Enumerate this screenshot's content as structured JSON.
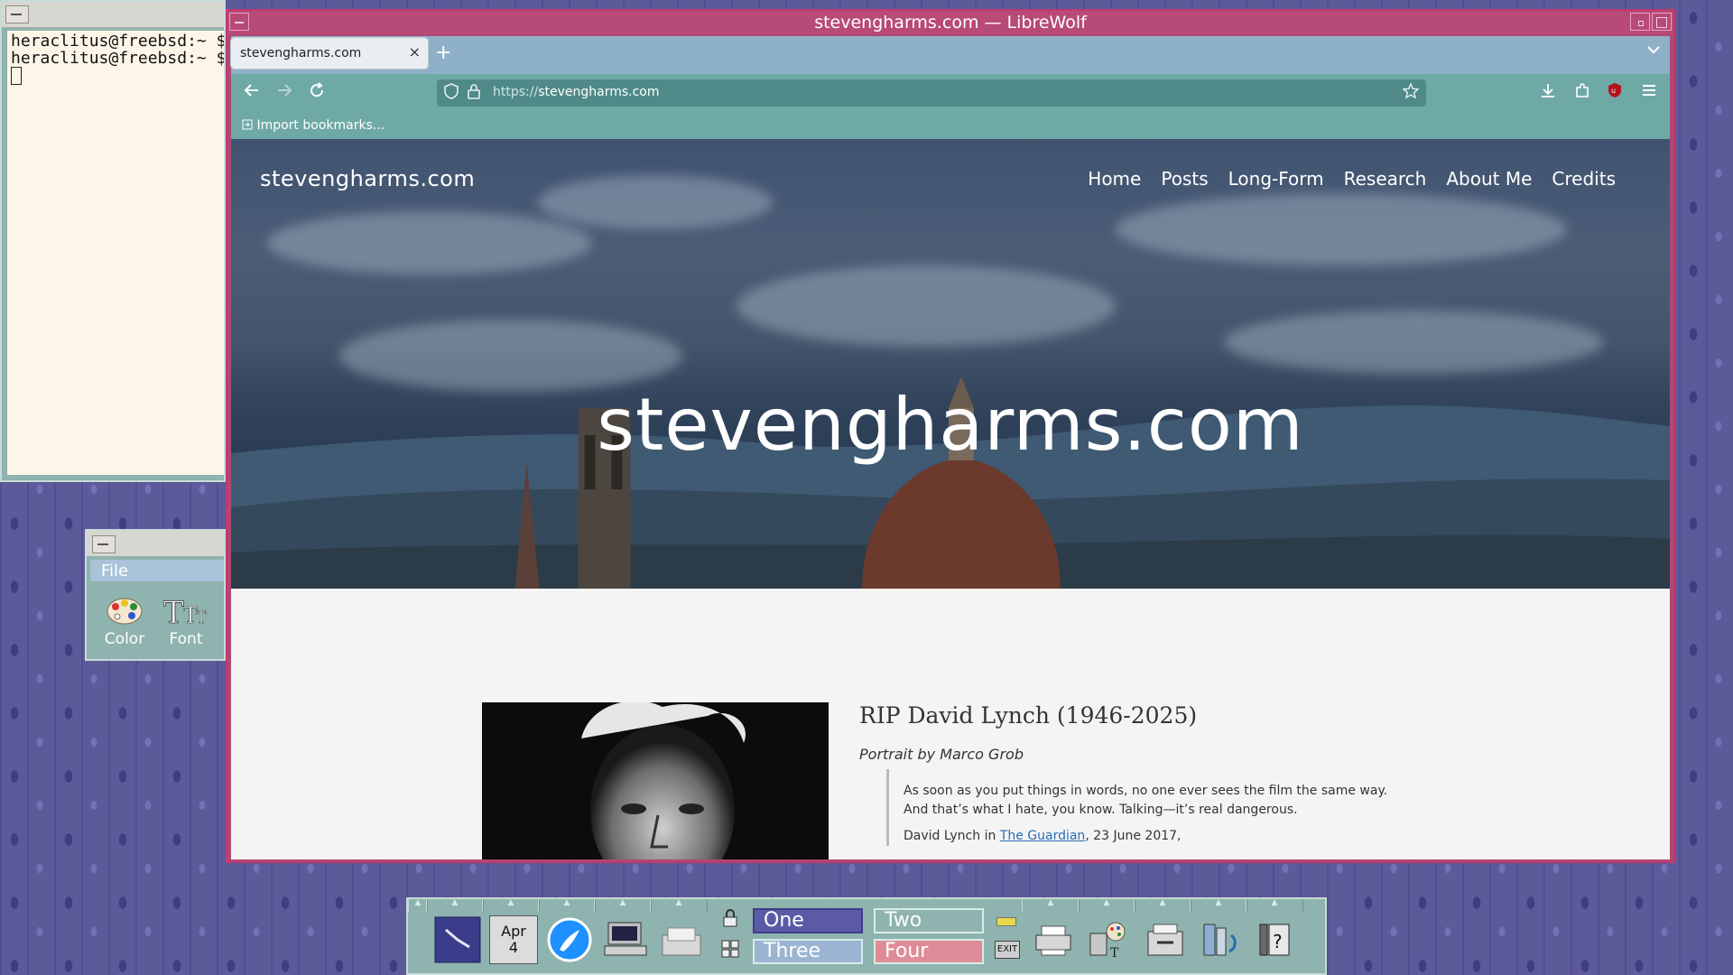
{
  "terminal": {
    "lines": [
      "heraclitus@freebsd:~ $",
      "heraclitus@freebsd:~ $"
    ]
  },
  "style_manager": {
    "menu_file": "File",
    "icons": [
      {
        "label": "Color",
        "icon": "palette-icon"
      },
      {
        "label": "Font",
        "icon": "font-icon"
      }
    ]
  },
  "browser": {
    "window_title": "stevengharms.com — LibreWolf",
    "tab_title": "stevengharms.com",
    "tab_close": "×",
    "new_tab": "+",
    "url_scheme": "https://",
    "url_host": "stevengharms.com",
    "bookmark_item": "Import bookmarks..."
  },
  "site": {
    "brand": "stevengharms.com",
    "nav": [
      "Home",
      "Posts",
      "Long-Form",
      "Research",
      "About Me",
      "Credits"
    ],
    "hero_title": "stevengharms.com",
    "post": {
      "title": "RIP David Lynch (1946-2025)",
      "subtitle": "Portrait by Marco Grob",
      "quote": "As soon as you put things in words, no one ever sees the film the same way. And that’s what I hate, you know. Talking—it’s real dangerous.",
      "citation_prefix": "David Lynch in ",
      "citation_link": "The Guardian",
      "citation_suffix": ", 23 June 2017,"
    }
  },
  "front_panel": {
    "calendar_month": "Apr",
    "calendar_day": "4",
    "workspaces": [
      "One",
      "Two",
      "Three",
      "Four"
    ],
    "exit_label": "EXIT"
  },
  "colors": {
    "browser_frame": "#b84a78",
    "tabstrip": "#8fb1c7",
    "toolbar": "#6fa9a6",
    "panel": "#8fb3ae"
  }
}
